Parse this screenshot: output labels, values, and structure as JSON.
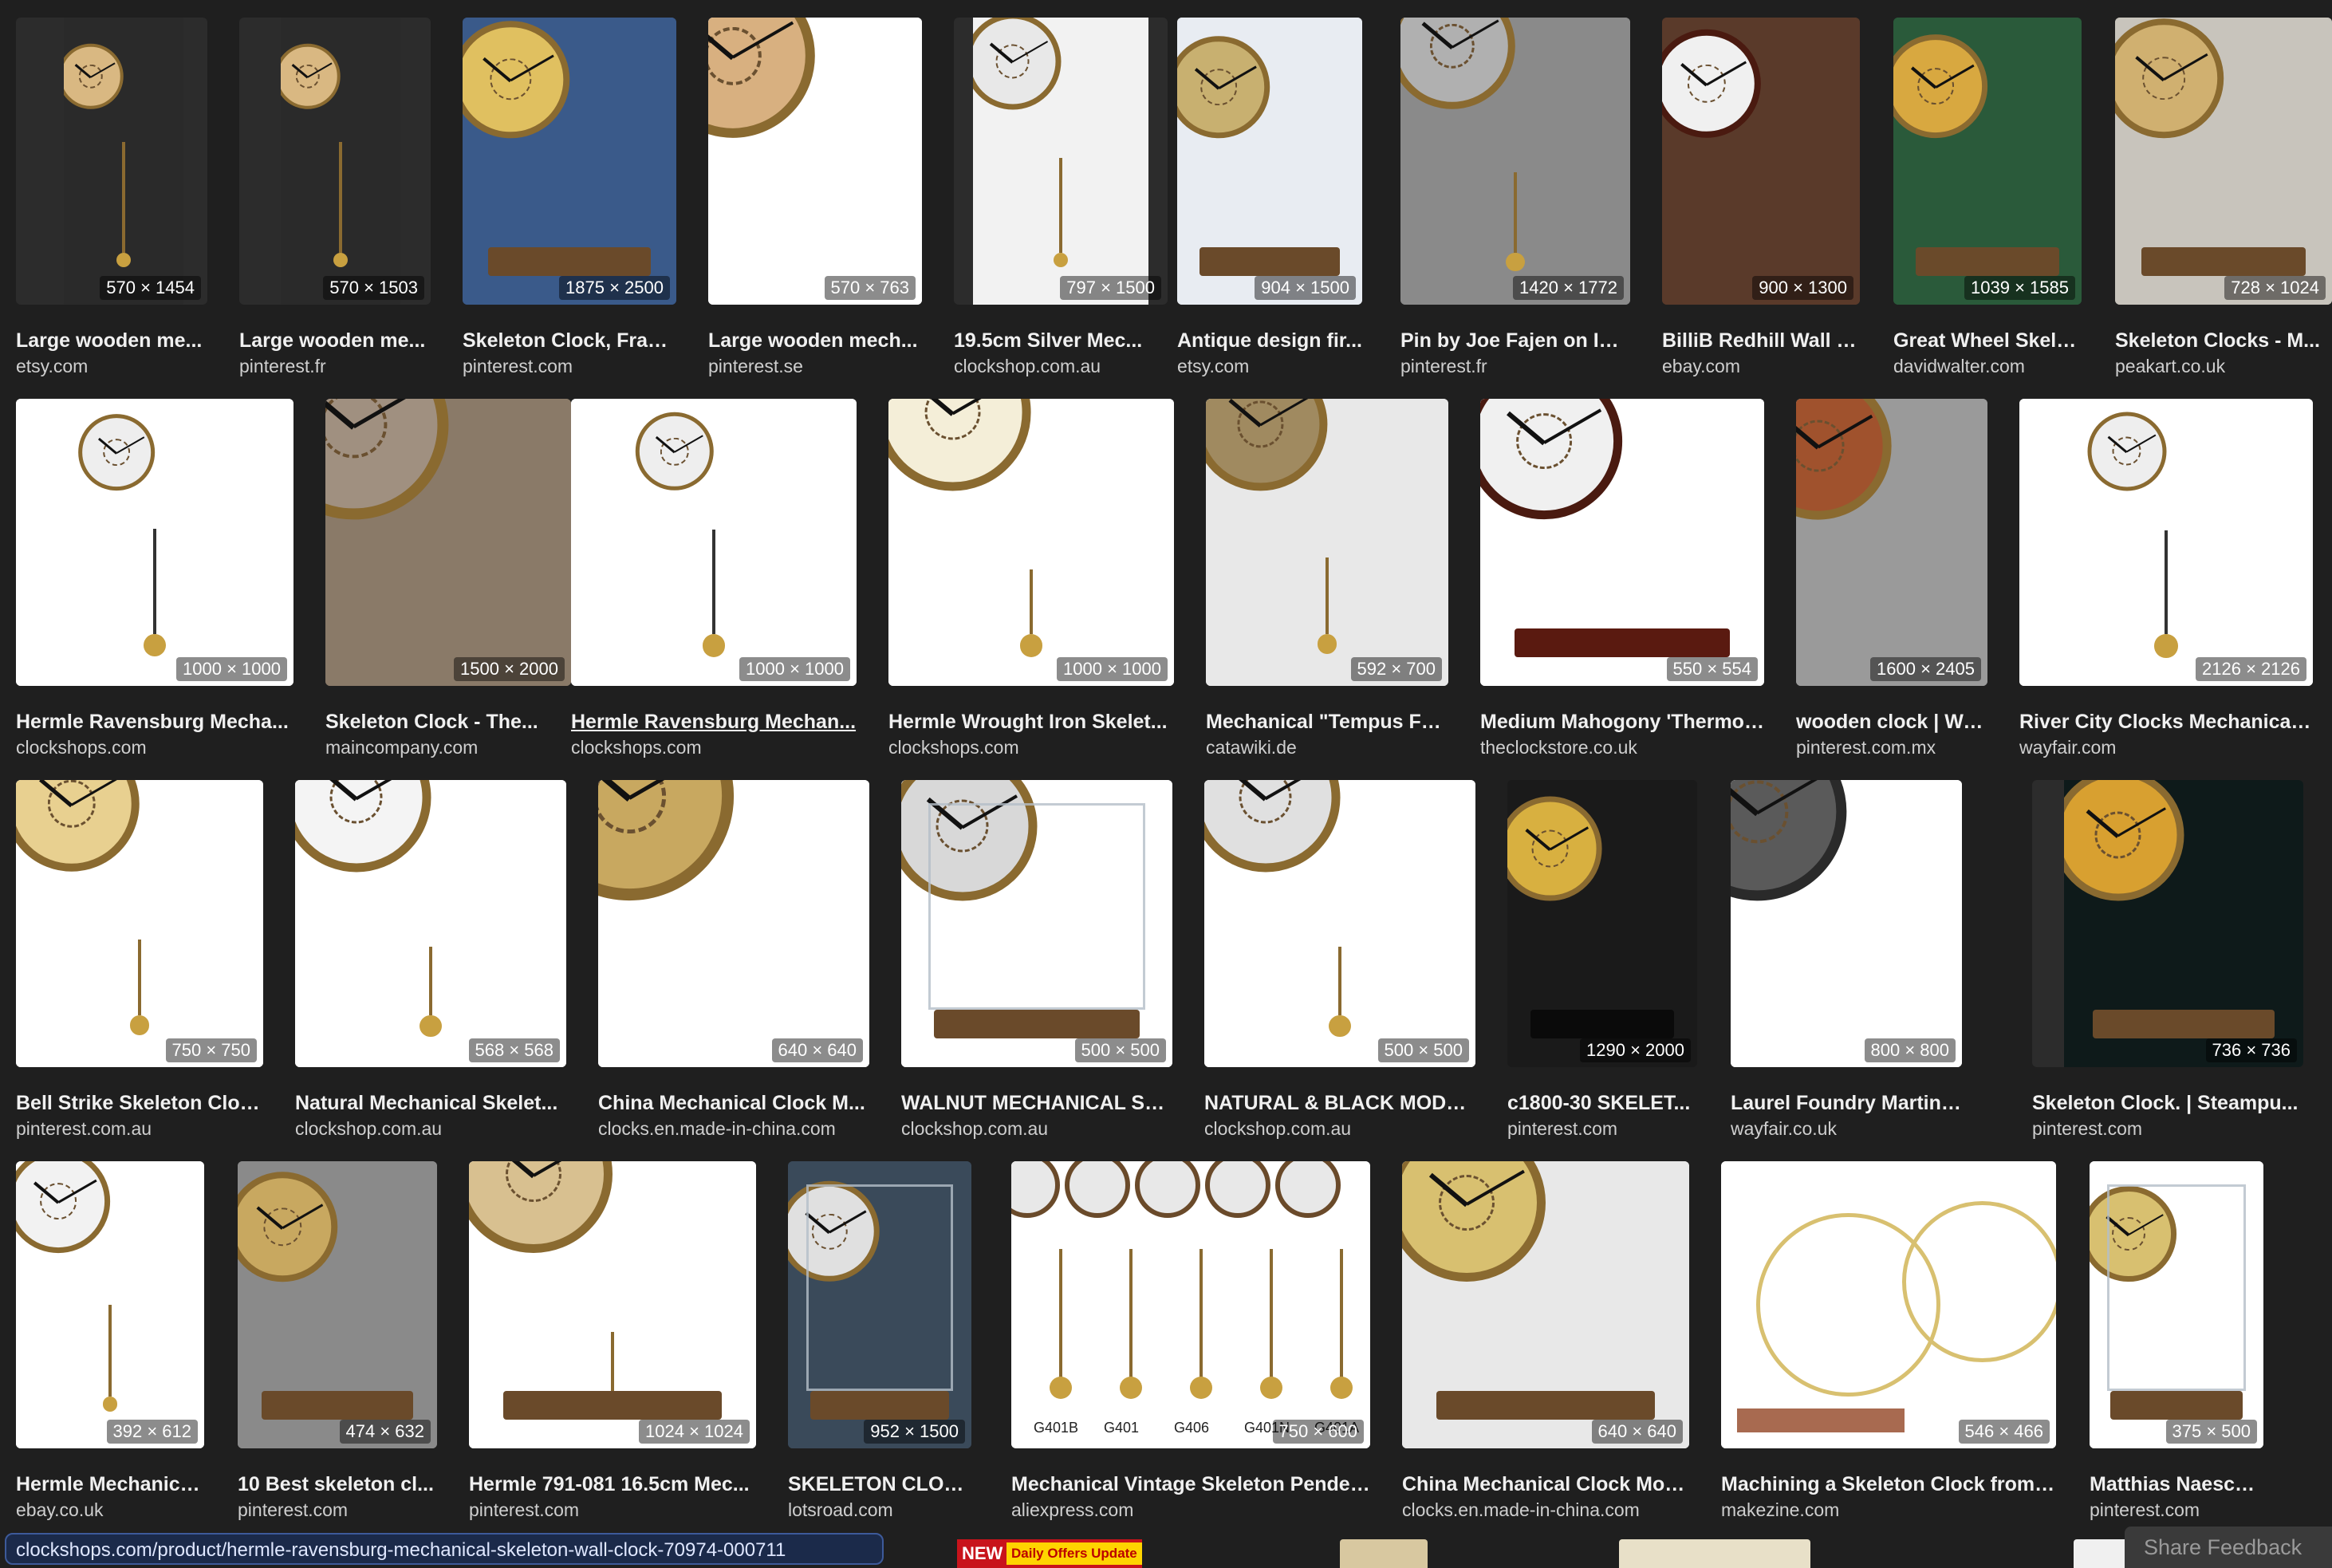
{
  "rows": [
    [
      {
        "dim": "570 × 1454",
        "title": "Large wooden me...",
        "source": "etsy.com",
        "bg": "#2a2a2a",
        "face": "#d9b882",
        "kind": "wood-pend"
      },
      {
        "dim": "570 × 1503",
        "title": "Large wooden me...",
        "source": "pinterest.fr",
        "bg": "#2a2a2a",
        "face": "#d9b882",
        "kind": "wood-pend"
      },
      {
        "dim": "1875 × 2500",
        "title": "Skeleton Clock, Fran...",
        "source": "pinterest.com",
        "bg": "#3a5a8a",
        "face": "#e0c060",
        "kind": "gold"
      },
      {
        "dim": "570 × 763",
        "title": "Large wooden mech...",
        "source": "pinterest.se",
        "bg": "#ffffff",
        "face": "#d8b080",
        "kind": "wood-big"
      },
      {
        "dim": "797 × 1500",
        "title": "19.5cm Silver Mec...",
        "source": "clockshop.com.au",
        "bg": "#f2f2f2",
        "face": "#e8e8e8",
        "kind": "silver"
      },
      {
        "dim": "904 × 1500",
        "title": "Antique design fir...",
        "source": "etsy.com",
        "bg": "#e8ecf2",
        "face": "#c8b070",
        "kind": "gold"
      },
      {
        "dim": "1420 × 1772",
        "title": "Pin by Joe Fajen on Int...",
        "source": "pinterest.fr",
        "bg": "#8a8a8a",
        "face": "#b0b0b0",
        "kind": "silver"
      },
      {
        "dim": "900 × 1300",
        "title": "BilliB Redhill Wall C...",
        "source": "ebay.com",
        "bg": "#5a3a2a",
        "face": "#f0f0f0",
        "kind": "wood-case"
      },
      {
        "dim": "1039 × 1585",
        "title": "Great Wheel Skele...",
        "source": "davidwalter.com",
        "bg": "#2a5a3a",
        "face": "#d8a840",
        "kind": "gold"
      },
      {
        "dim": "728 × 1024",
        "title": "Skeleton Clocks - M...",
        "source": "peakart.co.uk",
        "bg": "#c8c4bc",
        "face": "#d0b070",
        "kind": "gold"
      }
    ],
    [
      {
        "dim": "1000 × 1000",
        "title": "Hermle Ravensburg Mecha...",
        "source": "clockshops.com",
        "bg": "#ffffff",
        "face": "#eeeeee",
        "kind": "wall-pend"
      },
      {
        "dim": "1500 × 2000",
        "title": "Skeleton Clock - The...",
        "source": "maincompany.com",
        "bg": "#8a7a68",
        "face": "#a09080",
        "kind": "gears"
      },
      {
        "dim": "1000 × 1000",
        "title": "Hermle Ravensburg Mechan...",
        "source": "clockshops.com",
        "bg": "#ffffff",
        "face": "#eeeeee",
        "kind": "wall-pend",
        "link": true
      },
      {
        "dim": "1000 × 1000",
        "title": "Hermle Wrought Iron Skelet...",
        "source": "clockshops.com",
        "bg": "#ffffff",
        "face": "#f4eed8",
        "kind": "gold-frame"
      },
      {
        "dim": "592 × 700",
        "title": "Mechanical \"Tempus Fu...",
        "source": "catawiki.de",
        "bg": "#e8e8e8",
        "face": "#a08a60",
        "kind": "iron"
      },
      {
        "dim": "550 × 554",
        "title": "Medium Mahogony 'Thermo'...",
        "source": "theclockstore.co.uk",
        "bg": "#ffffff",
        "face": "#f0f0f0",
        "kind": "mahogany"
      },
      {
        "dim": "1600 × 2405",
        "title": "wooden clock | Wo...",
        "source": "pinterest.com.mx",
        "bg": "#9a9a9a",
        "face": "#a0522d",
        "kind": "wood-big"
      },
      {
        "dim": "2126 × 2126",
        "title": "River City Clocks Mechanical...",
        "source": "wayfair.com",
        "bg": "#ffffff",
        "face": "#eeeeee",
        "kind": "wall-pend"
      }
    ],
    [
      {
        "dim": "750 × 750",
        "title": "Bell Strike Skeleton Cloc...",
        "source": "pinterest.com.au",
        "bg": "#ffffff",
        "face": "#e8d090",
        "kind": "gold-frame"
      },
      {
        "dim": "568 × 568",
        "title": "Natural Mechanical Skelet...",
        "source": "clockshop.com.au",
        "bg": "#ffffff",
        "face": "#f4f4f4",
        "kind": "natural"
      },
      {
        "dim": "640 × 640",
        "title": "China Mechanical Clock M...",
        "source": "clocks.en.made-in-china.com",
        "bg": "#ffffff",
        "face": "#c8a860",
        "kind": "gears"
      },
      {
        "dim": "500 × 500",
        "title": "WALNUT MECHANICAL SK...",
        "source": "clockshop.com.au",
        "bg": "#ffffff",
        "face": "#d8d8d8",
        "kind": "glass"
      },
      {
        "dim": "500 × 500",
        "title": "NATURAL & BLACK MODE...",
        "source": "clockshop.com.au",
        "bg": "#ffffff",
        "face": "#e0e0e0",
        "kind": "natural"
      },
      {
        "dim": "1290 × 2000",
        "title": "c1800-30 SKELET...",
        "source": "pinterest.com",
        "bg": "#1a1a1a",
        "face": "#d8b040",
        "kind": "dark"
      },
      {
        "dim": "800 × 800",
        "title": "Laurel Foundry Martingale ...",
        "source": "wayfair.co.uk",
        "bg": "#ffffff",
        "face": "#5a5a5a",
        "kind": "wall-round"
      },
      {
        "dim": "736 × 736",
        "title": "Skeleton Clock. | Steampu...",
        "source": "pinterest.com",
        "bg": "#0e1a1a",
        "face": "#d8a030",
        "kind": "gold"
      }
    ],
    [
      {
        "dim": "392 × 612",
        "title": "Hermle Mechanica...",
        "source": "ebay.co.uk",
        "bg": "#ffffff",
        "face": "#f2f2f2",
        "kind": "iron"
      },
      {
        "dim": "474 × 632",
        "title": "10 Best skeleton cl...",
        "source": "pinterest.com",
        "bg": "#8a8a8a",
        "face": "#c8a860",
        "kind": "gold"
      },
      {
        "dim": "1024 × 1024",
        "title": "Hermle 791-081 16.5cm Mec...",
        "source": "pinterest.com",
        "bg": "#ffffff",
        "face": "#d8c090",
        "kind": "tower"
      },
      {
        "dim": "952 × 1500",
        "title": "SKELETON CLOC...",
        "source": "lotsroad.com",
        "bg": "#3a4a5a",
        "face": "#e0e0e0",
        "kind": "glass"
      },
      {
        "dim": "750 × 600",
        "title": "Mechanical Vintage Skeleton Pendel...",
        "source": "aliexpress.com",
        "bg": "#ffffff",
        "face": "#e8e8e8",
        "kind": "multi"
      },
      {
        "dim": "640 × 640",
        "title": "China Mechanical Clock Mov...",
        "source": "clocks.en.made-in-china.com",
        "bg": "#e8e8e8",
        "face": "#d8c070",
        "kind": "movement"
      },
      {
        "dim": "546 × 466",
        "title": "Machining a Skeleton Clock from ...",
        "source": "makezine.com",
        "bg": "#ffffff",
        "face": "#d8c070",
        "kind": "great-wheel"
      },
      {
        "dim": "375 × 500",
        "title": "Matthias Naeschke - ...",
        "source": "pinterest.com",
        "bg": "#ffffff",
        "face": "#d8c070",
        "kind": "glass"
      }
    ]
  ],
  "status": {
    "url": "clockshops.com/product/hermle-ravensburg-mechanical-skeleton-wall-clock-70974-000711"
  },
  "ad": {
    "new": "NEW",
    "daily": "Daily Offers Update"
  },
  "feedback": {
    "label": "Share Feedback"
  },
  "multi_labels": [
    "G401B",
    "G401",
    "G406",
    "G401N",
    "G401A"
  ]
}
